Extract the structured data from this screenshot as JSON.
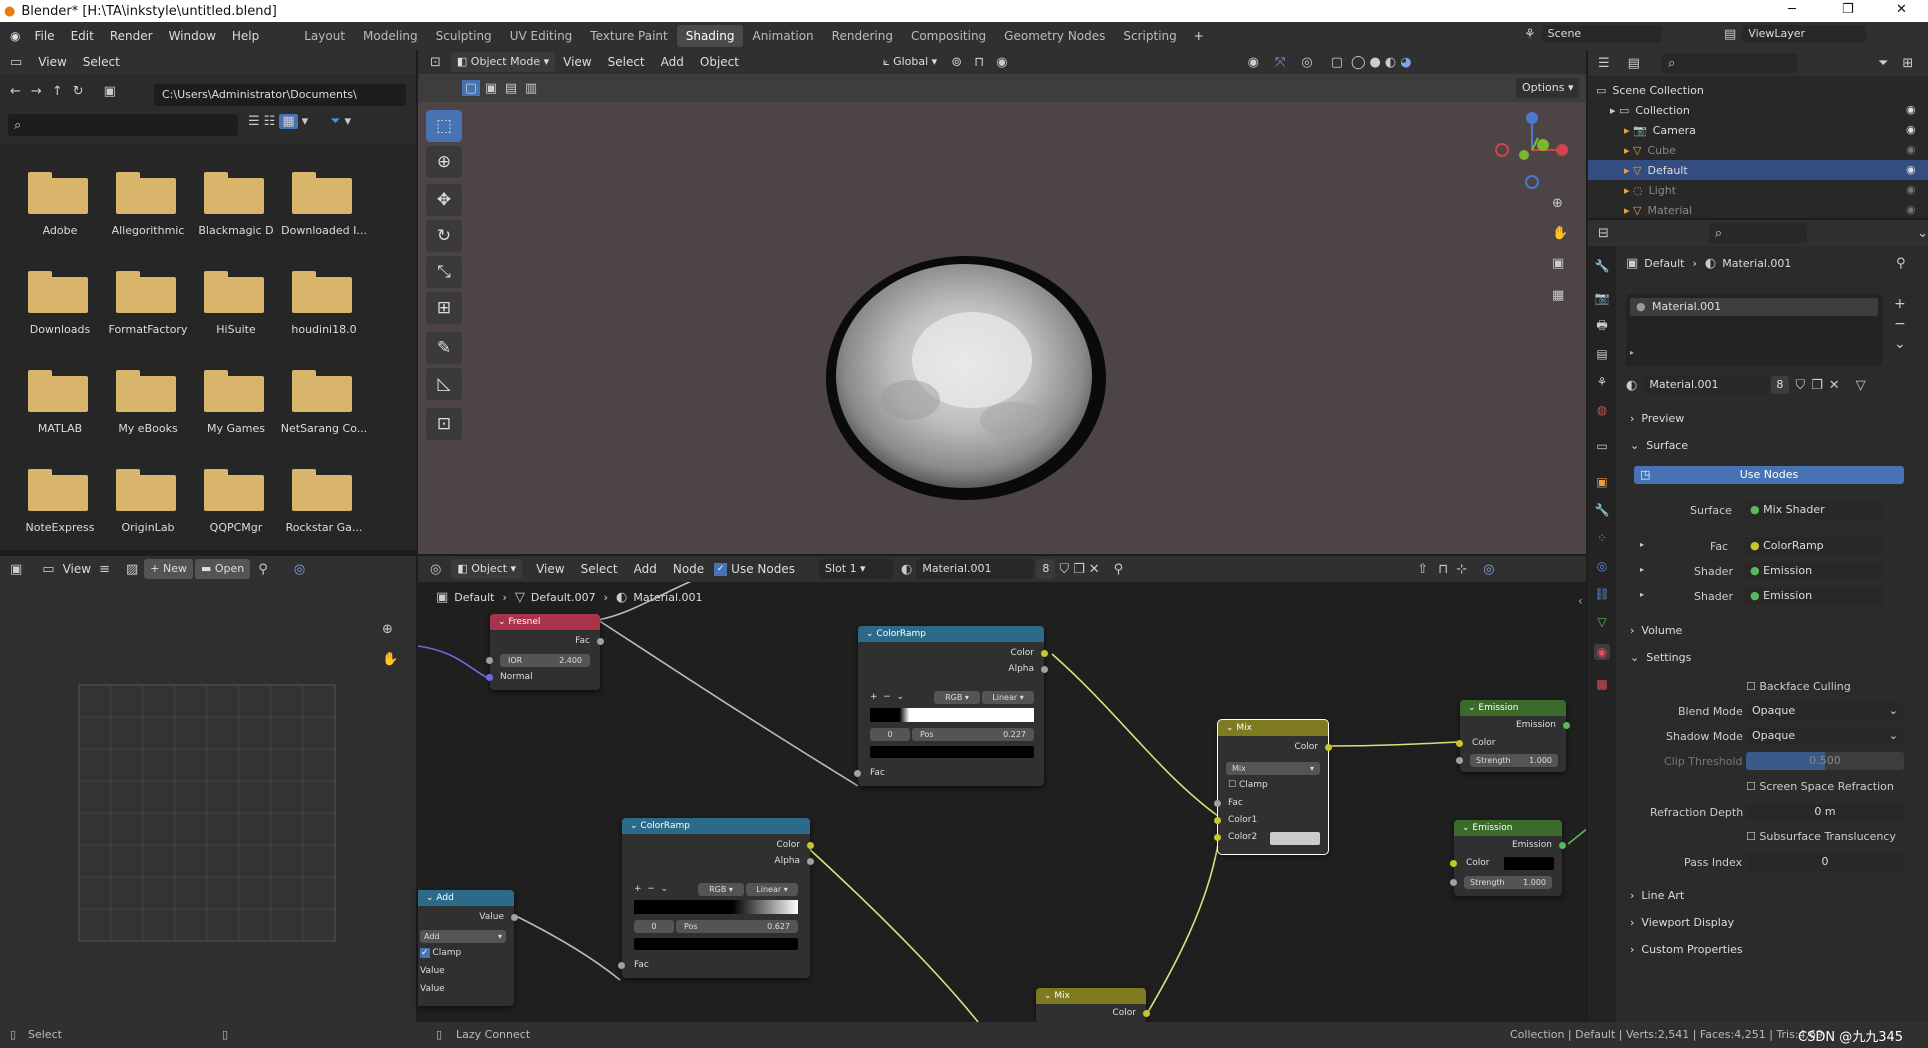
{
  "window": {
    "title": "Blender* [H:\\TA\\inkstyle\\untitled.blend]",
    "minimize": "─",
    "maximize": "❐",
    "close": "✕"
  },
  "menu": {
    "items": [
      "File",
      "Edit",
      "Render",
      "Window",
      "Help"
    ],
    "tabs": [
      "Layout",
      "Modeling",
      "Sculpting",
      "UV Editing",
      "Texture Paint",
      "Shading",
      "Animation",
      "Rendering",
      "Compositing",
      "Geometry Nodes",
      "Scripting"
    ],
    "add_tab": "+",
    "scene": "Scene",
    "viewlayer": "ViewLayer"
  },
  "filebrowser": {
    "menu": [
      "View",
      "Select"
    ],
    "path": "C:\\Users\\Administrator\\Documents\\",
    "folders": [
      "Adobe",
      "Allegorithmic",
      "Blackmagic D",
      "Downloaded I...",
      "Downloads",
      "FormatFactory",
      "HiSuite",
      "houdini18.0",
      "MATLAB",
      "My eBooks",
      "My Games",
      "NetSarang Co...",
      "NoteExpress",
      "OriginLab",
      "QQPCMgr",
      "Rockstar Ga..."
    ]
  },
  "imageeditor": {
    "view": "View",
    "new": "New",
    "open": "Open"
  },
  "viewport": {
    "mode": "Object Mode",
    "menu": [
      "View",
      "Select",
      "Add",
      "Object"
    ],
    "orientation": "Global",
    "options": "Options"
  },
  "nodeeditor": {
    "type": "Object",
    "menu": [
      "View",
      "Select",
      "Add",
      "Node"
    ],
    "use_nodes": "Use Nodes",
    "slot": "Slot 1",
    "material": "Material.001",
    "users": "8",
    "breadcrumb": [
      "Default",
      "Default.007",
      "Material.001"
    ]
  },
  "nodes": {
    "fresnel": {
      "title": "Fresnel",
      "fac": "Fac",
      "ior_label": "IOR",
      "ior": "2.400",
      "normal": "Normal"
    },
    "ramp1": {
      "title": "ColorRamp",
      "color": "Color",
      "alpha": "Alpha",
      "mode": "RGB",
      "interp": "Linear",
      "index": "0",
      "pos_label": "Pos",
      "pos": "0.227",
      "fac": "Fac"
    },
    "ramp2": {
      "title": "ColorRamp",
      "color": "Color",
      "alpha": "Alpha",
      "mode": "RGB",
      "interp": "Linear",
      "index": "0",
      "pos_label": "Pos",
      "pos": "0.627",
      "fac": "Fac"
    },
    "mix": {
      "title": "Mix",
      "color": "Color",
      "blend": "Mix",
      "clamp": "Clamp",
      "fac": "Fac",
      "color1": "Color1",
      "color2": "Color2"
    },
    "mix2": {
      "title": "Mix",
      "color": "Color"
    },
    "emission1": {
      "title": "Emission",
      "out": "Emission",
      "color": "Color",
      "strength_label": "Strength",
      "strength": "1.000"
    },
    "emission2": {
      "title": "Emission",
      "out": "Emission",
      "color": "Color",
      "strength_label": "Strength",
      "strength": "1.000"
    },
    "add": {
      "title": "Add",
      "value": "Value",
      "op": "Add",
      "clamp": "Clamp",
      "v1": "Value",
      "v2": "Value"
    }
  },
  "outliner": {
    "items": [
      {
        "label": "Scene Collection",
        "dim": false
      },
      {
        "label": "Collection",
        "dim": false
      },
      {
        "label": "Camera",
        "dim": false
      },
      {
        "label": "Cube",
        "dim": true
      },
      {
        "label": "Default",
        "dim": false,
        "selected": true
      },
      {
        "label": "Light",
        "dim": true
      },
      {
        "label": "Material",
        "dim": true
      }
    ]
  },
  "properties": {
    "crumb_obj": "Default",
    "crumb_mat": "Material.001",
    "slot": "Material.001",
    "material": "Material.001",
    "users": "8",
    "preview": "Preview",
    "surface": "Surface",
    "use_nodes": "Use Nodes",
    "surface_label": "Surface",
    "surface_val": "Mix Shader",
    "fac_label": "Fac",
    "fac_val": "ColorRamp",
    "shader_label": "Shader",
    "shader1": "Emission",
    "shader2": "Emission",
    "volume": "Volume",
    "settings": "Settings",
    "backface": "Backface Culling",
    "blend_label": "Blend Mode",
    "blend": "Opaque",
    "shadow_label": "Shadow Mode",
    "shadow": "Opaque",
    "clip_label": "Clip Threshold",
    "clip": "0.500",
    "ssr": "Screen Space Refraction",
    "refr_label": "Refraction Depth",
    "refr": "0 m",
    "sst": "Subsurface Translucency",
    "pass_label": "Pass Index",
    "pass": "0",
    "lineart": "Line Art",
    "vpd": "Viewport Display",
    "custom": "Custom Properties"
  },
  "status": {
    "left": "Select",
    "middle": "Lazy Connect",
    "right": "Collection | Default | Verts:2,541 | Faces:4,251 | Tris:4,69",
    "watermark": "CSDN @九九345"
  },
  "colors": {
    "accent": "#4772b3",
    "fresnel": "#a8334a",
    "ramp": "#2c6a8a",
    "mix": "#7d7a20",
    "emission": "#3a6b2a",
    "add": "#2c6a8a"
  }
}
